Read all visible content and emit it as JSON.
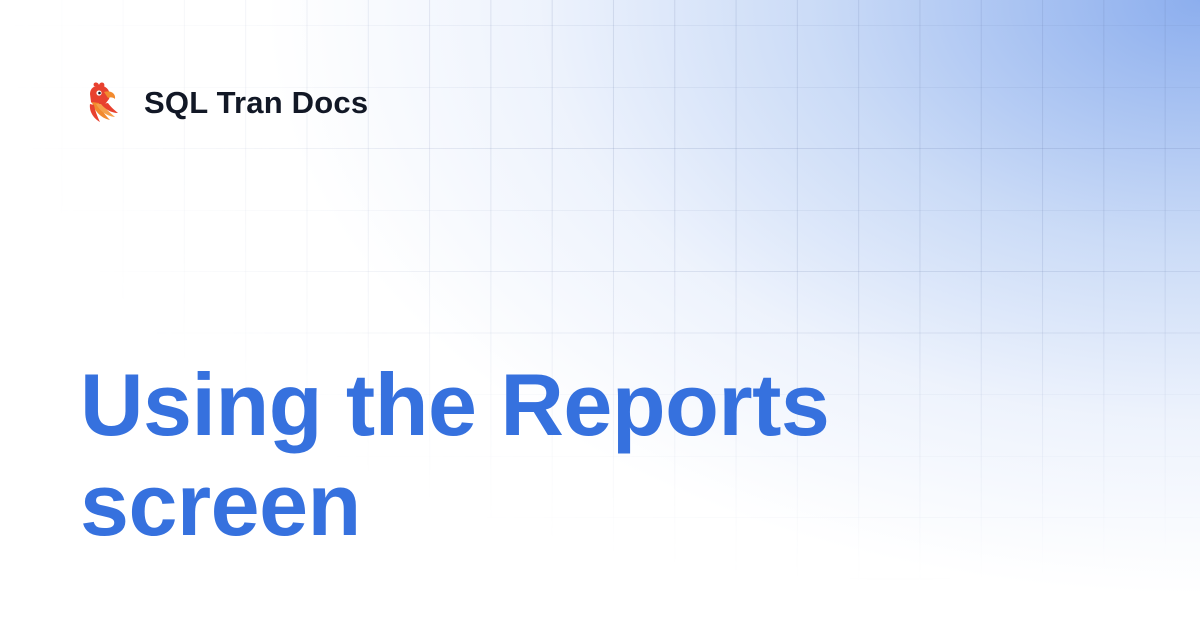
{
  "brand": {
    "name": "SQL Tran Docs",
    "logo_icon": "parrot-logo-icon"
  },
  "page": {
    "title": "Using the Reports screen"
  },
  "colors": {
    "title": "#3671de",
    "brand_text": "#121826",
    "gradient_accent": "#8fb0ec",
    "logo_red": "#e8412f",
    "logo_orange": "#f28a2e"
  }
}
